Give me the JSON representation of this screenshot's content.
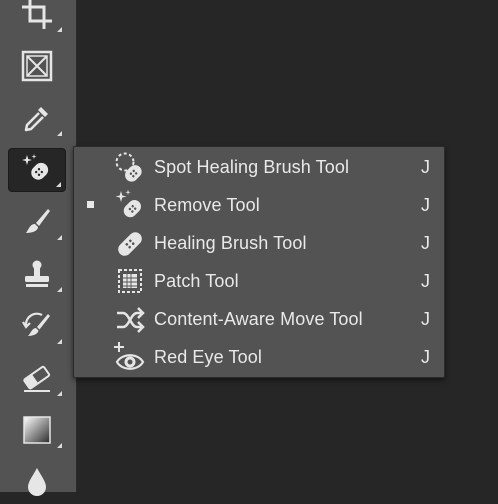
{
  "colors": {
    "canvas_bg": "#262626",
    "panel_bg": "#535353",
    "text": "#e9e9e9",
    "icon": "#e6e6e6"
  },
  "toolbar": {
    "tools": [
      {
        "name": "crop-tool",
        "icon": "crop-icon",
        "active": false,
        "has_flyout": true
      },
      {
        "name": "frame-tool",
        "icon": "frame-icon",
        "active": false,
        "has_flyout": false
      },
      {
        "name": "eyedropper-tool",
        "icon": "eyedropper-icon",
        "active": false,
        "has_flyout": true
      },
      {
        "name": "remove-tool",
        "icon": "remove-tool-icon",
        "active": true,
        "has_flyout": true
      },
      {
        "name": "brush-tool",
        "icon": "brush-icon",
        "active": false,
        "has_flyout": true
      },
      {
        "name": "clone-stamp-tool",
        "icon": "stamp-icon",
        "active": false,
        "has_flyout": true
      },
      {
        "name": "history-brush-tool",
        "icon": "history-brush-icon",
        "active": false,
        "has_flyout": true
      },
      {
        "name": "eraser-tool",
        "icon": "eraser-icon",
        "active": false,
        "has_flyout": true
      },
      {
        "name": "gradient-tool",
        "icon": "gradient-icon",
        "active": false,
        "has_flyout": true
      },
      {
        "name": "blur-tool",
        "icon": "drop-icon",
        "active": false,
        "has_flyout": false
      }
    ]
  },
  "flyout": {
    "items": [
      {
        "label": "Spot Healing Brush Tool",
        "shortcut": "J",
        "icon": "spot-healing-brush-icon",
        "selected": false
      },
      {
        "label": "Remove Tool",
        "shortcut": "J",
        "icon": "remove-tool-icon",
        "selected": true
      },
      {
        "label": "Healing Brush Tool",
        "shortcut": "J",
        "icon": "healing-brush-icon",
        "selected": false
      },
      {
        "label": "Patch Tool",
        "shortcut": "J",
        "icon": "patch-icon",
        "selected": false
      },
      {
        "label": "Content-Aware Move Tool",
        "shortcut": "J",
        "icon": "content-aware-move-icon",
        "selected": false
      },
      {
        "label": "Red Eye Tool",
        "shortcut": "J",
        "icon": "red-eye-icon",
        "selected": false
      }
    ]
  }
}
